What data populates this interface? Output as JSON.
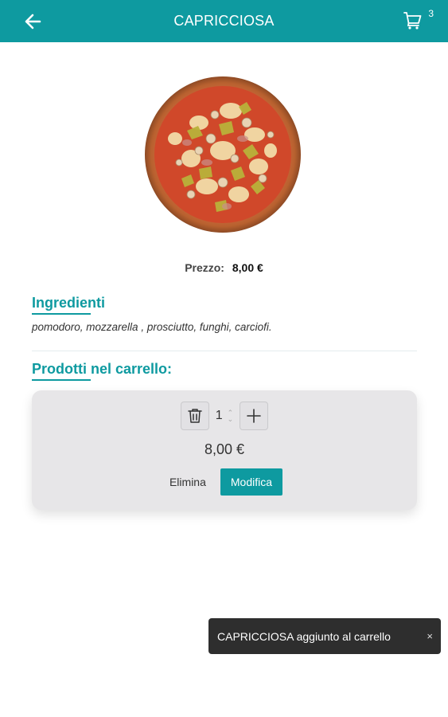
{
  "header": {
    "title": "CAPRICCIOSA",
    "back_icon": "arrow-left-icon",
    "cart_icon": "shopping-cart-icon",
    "cart_count": "3",
    "bg_color": "#0e9aa0"
  },
  "product": {
    "image_icon": "pizza-image",
    "price_label": "Prezzo:",
    "price_value": "8,00 €"
  },
  "ingredients": {
    "title": "Ingredienti",
    "text": "pomodoro, mozzarella , prosciutto, funghi, carciofi."
  },
  "cart_section": {
    "title": "Prodotti nel carrello:",
    "item": {
      "quantity": "1",
      "line_price": "8,00 €",
      "delete_icon": "trash-icon",
      "plus_icon": "plus-icon",
      "remove_label": "Elimina",
      "edit_label": "Modifica"
    }
  },
  "toast": {
    "message": "CAPRICCIOSA aggiunto al carrello",
    "close_label": "×"
  }
}
